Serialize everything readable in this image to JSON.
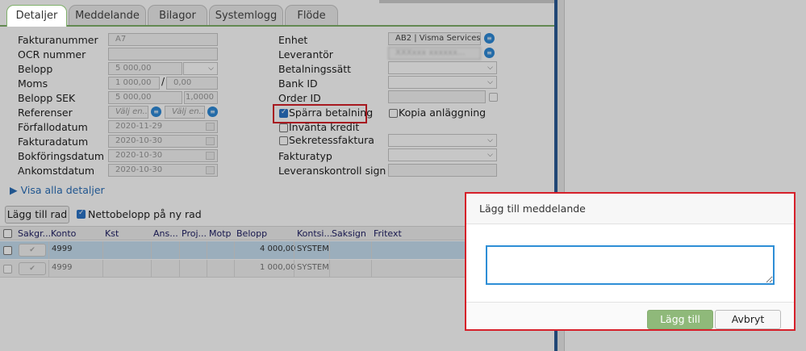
{
  "tabs": [
    "Detaljer",
    "Meddelande",
    "Bilagor",
    "Systemlogg",
    "Flöde"
  ],
  "left_fields": {
    "fakturanummer": {
      "label": "Fakturanummer",
      "value": "A7"
    },
    "ocr": {
      "label": "OCR nummer",
      "value": ""
    },
    "belopp": {
      "label": "Belopp",
      "value": "5 000,00"
    },
    "moms": {
      "label": "Moms",
      "value": "1 000,00",
      "slash": "/",
      "value2": "0,00"
    },
    "belopp_sek": {
      "label": "Belopp SEK",
      "value": "5 000,00",
      "rate": "1,0000"
    },
    "referenser": {
      "label": "Referenser",
      "placeholder1": "Välj en...",
      "placeholder2": "Välj en..."
    },
    "forfallodatum": {
      "label": "Förfallodatum",
      "value": "2020-11-29"
    },
    "fakturadatum": {
      "label": "Fakturadatum",
      "value": "2020-10-30"
    },
    "bokforingsdatum": {
      "label": "Bokföringsdatum",
      "value": "2020-10-30"
    },
    "ankomstdatum": {
      "label": "Ankomstdatum",
      "value": "2020-10-30"
    }
  },
  "right_fields": {
    "enhet": {
      "label": "Enhet",
      "value": "AB2 | Visma Services ..."
    },
    "leverantor": {
      "label": "Leverantör",
      "value": "XXXxxx xxxxxx..."
    },
    "betalningssatt": {
      "label": "Betalningssätt"
    },
    "bank_id": {
      "label": "Bank ID"
    },
    "order_id": {
      "label": "Order ID"
    },
    "sparra": {
      "label": "Spärra betalning",
      "checked": true
    },
    "kopia": {
      "label": "Kopia anläggning",
      "checked": false
    },
    "invanta": {
      "label": "Invänta kredit",
      "checked": false
    },
    "sekretess": {
      "label": "Sekretessfaktura",
      "checked": false
    },
    "fakturatyp": {
      "label": "Fakturatyp"
    },
    "leveranskontroll": {
      "label": "Leveranskontroll sign"
    }
  },
  "visa_alla": "▶ Visa alla detaljer",
  "toolbar": {
    "add_row": "Lägg till rad",
    "nettobelopp": "Nettobelopp på ny rad",
    "nettobelopp_checked": true
  },
  "grid": {
    "headers": [
      "Sakgr...",
      "Konto",
      "Kst",
      "Ans...",
      "Proj...",
      "Motp",
      "Belopp",
      "Kontsi...",
      "Saksign",
      "Fritext"
    ],
    "rows": [
      {
        "konto": "4999",
        "belopp": "4 000,00",
        "kontsign": "SYSTEM",
        "check_icon": "✔"
      },
      {
        "konto": "4999",
        "belopp": "1 000,00",
        "kontsign": "SYSTEM",
        "check_icon": "✔"
      }
    ]
  },
  "dialog": {
    "title": "Lägg till meddelande",
    "textarea_value": "",
    "ok": "Lägg till",
    "cancel": "Avbryt"
  },
  "colors": {
    "accent_green": "#7fb06a",
    "blue": "#2e8ed6",
    "red_highlight": "#d6202a"
  }
}
